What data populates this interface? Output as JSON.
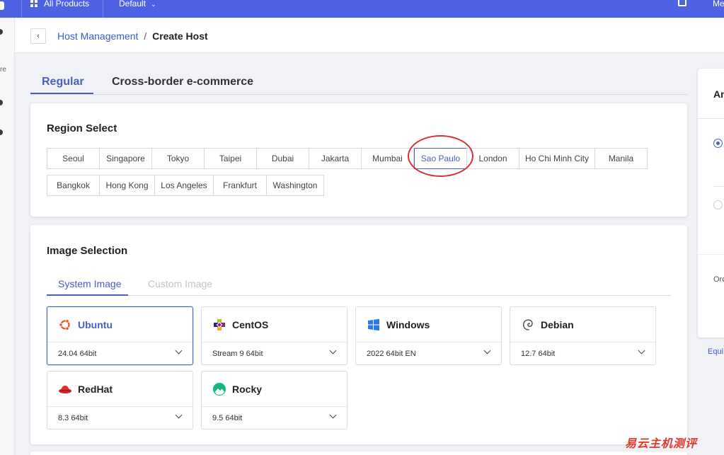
{
  "topbar": {
    "all_products": "All Products",
    "default_label": "Default",
    "right_label": "Me"
  },
  "sidebar": {
    "partial_text": "re"
  },
  "breadcrumb": {
    "parent": "Host Management",
    "separator": "/",
    "current": "Create Host"
  },
  "main_tabs": [
    {
      "label": "Regular",
      "active": true
    },
    {
      "label": "Cross-border e-commerce",
      "active": false
    }
  ],
  "region": {
    "title": "Region Select",
    "selected": "Sao Paulo",
    "items": [
      "Seoul",
      "Singapore",
      "Tokyo",
      "Taipei",
      "Dubai",
      "Jakarta",
      "Mumbai",
      "Sao Paulo",
      "London",
      "Ho Chi Minh City",
      "Manila",
      "Bangkok",
      "Hong Kong",
      "Los Angeles",
      "Frankfurt",
      "Washington"
    ]
  },
  "image": {
    "title": "Image Selection",
    "tabs": [
      {
        "label": "System Image",
        "active": true
      },
      {
        "label": "Custom Image",
        "active": false
      }
    ],
    "os": [
      {
        "name": "Ubuntu",
        "version": "24.04 64bit",
        "icon": "ubuntu-icon",
        "selected": true
      },
      {
        "name": "CentOS",
        "version": "Stream 9 64bit",
        "icon": "centos-icon",
        "selected": false
      },
      {
        "name": "Windows",
        "version": "2022 64bit EN",
        "icon": "windows-icon",
        "selected": false
      },
      {
        "name": "Debian",
        "version": "12.7 64bit",
        "icon": "debian-icon",
        "selected": false
      },
      {
        "name": "RedHat",
        "version": "8.3 64bit",
        "icon": "redhat-icon",
        "selected": false
      },
      {
        "name": "Rocky",
        "version": "9.5 64bit",
        "icon": "rocky-icon",
        "selected": false
      }
    ]
  },
  "right_panel": {
    "title_partial": "An",
    "order_partial": "Orc",
    "link_partial": "Equi"
  },
  "watermark": "易云主机测评",
  "colors": {
    "topbar": "#4d63e3",
    "accent": "#4a5fc1",
    "highlight": "#d93030"
  }
}
